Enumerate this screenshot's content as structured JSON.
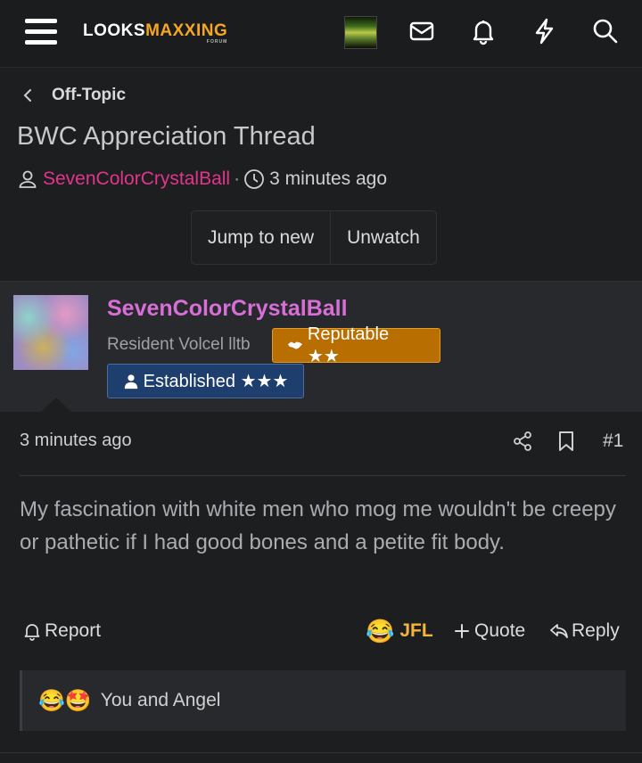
{
  "header": {
    "logo_part1": "LOOKS",
    "logo_part2": "MAXXING",
    "logo_sub": "FORUM",
    "icons": [
      "menu-icon",
      "mail-icon",
      "bell-icon",
      "bolt-icon",
      "search-icon"
    ]
  },
  "breadcrumb": {
    "label": "Off-Topic"
  },
  "thread": {
    "title": "BWC Appreciation Thread",
    "author": "SevenColorCrystalBall",
    "separator": "·",
    "time": "3 minutes ago",
    "jump_label": "Jump to new",
    "unwatch_label": "Unwatch"
  },
  "post": {
    "username": "SevenColorCrystalBall",
    "user_title": "Resident Volcel lltb",
    "badge_reputable": "Reputable ★★",
    "badge_established": "Established ★★★",
    "time": "3 minutes ago",
    "number": "#1",
    "body": "My fascination with white men who mog me wouldn't be creepy or pathetic if I had good bones and a petite fit body.",
    "report_label": "Report",
    "reaction_emoji": "😂",
    "reaction_label": "JFL",
    "quote_label": "Quote",
    "reply_label": "Reply",
    "reactions_emojis": "😂🤩",
    "reactions_text": "You and Angel"
  },
  "colors": {
    "accent_orange": "#f5a623",
    "author_pink": "#e3348c",
    "username_violet": "#d86fd8",
    "reputable_bg": "#b86e00",
    "established_bg": "#1e3f6e"
  }
}
